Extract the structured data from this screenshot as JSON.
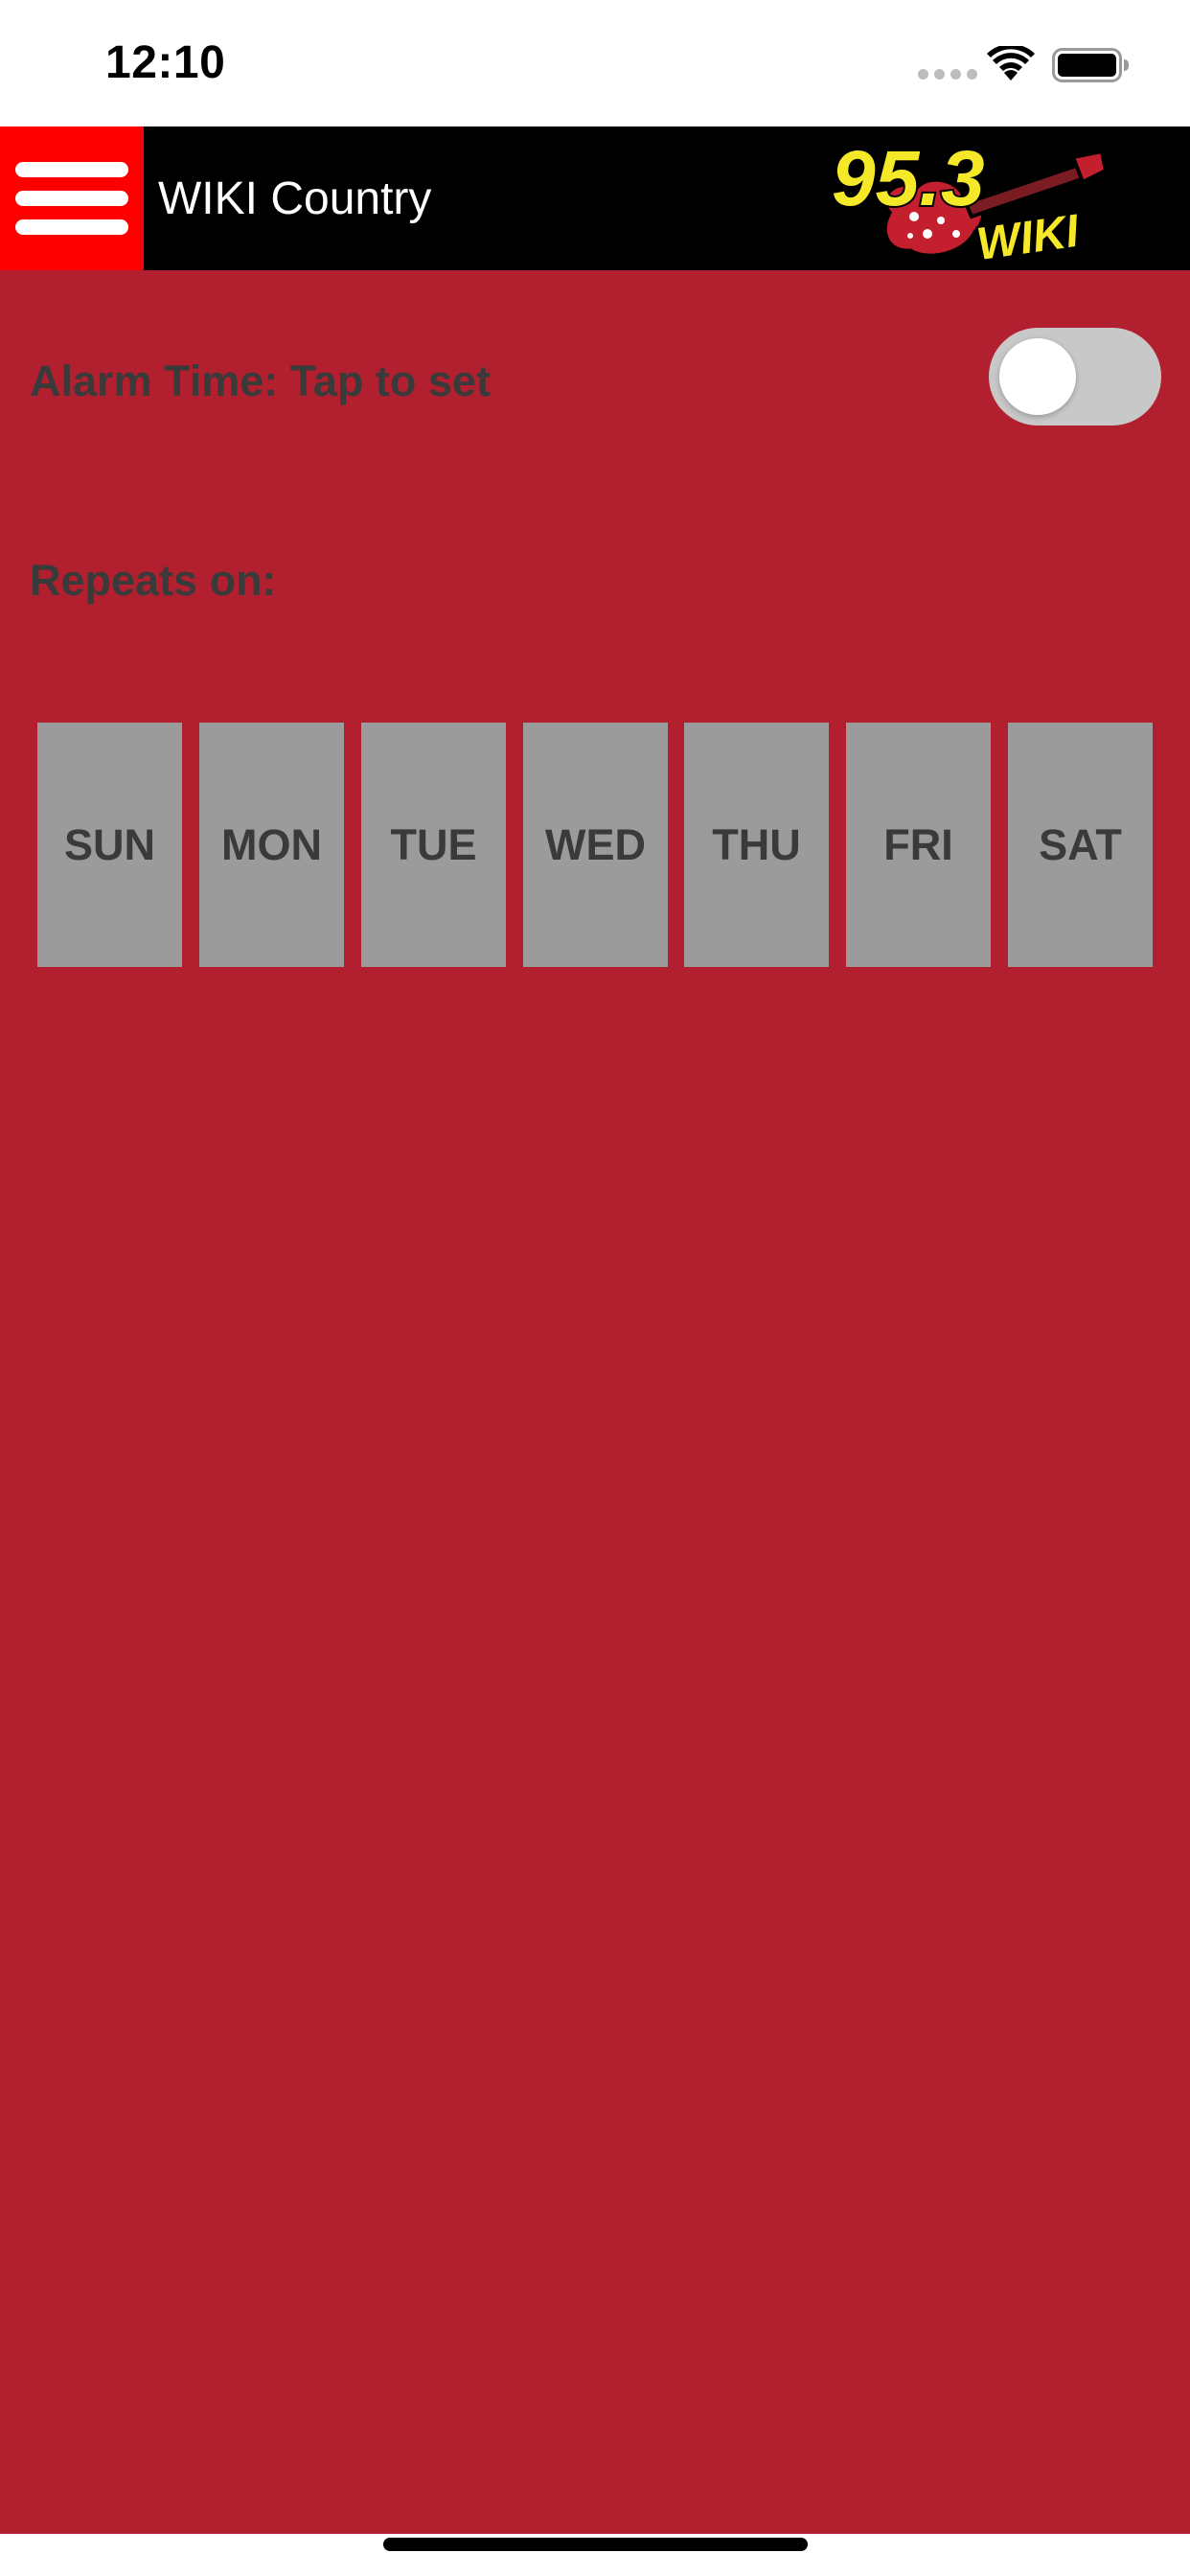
{
  "status_bar": {
    "time": "12:10",
    "icons": [
      "cellular-signal-icon",
      "wifi-icon",
      "battery-icon"
    ]
  },
  "header": {
    "menu_icon": "hamburger-menu-icon",
    "title": "WIKI Country",
    "logo": {
      "number_text": "95.3",
      "call_letters": "WIKI",
      "colors": {
        "number": "#f5e829",
        "guitar": "#c41f2e",
        "outline": "#000000"
      }
    }
  },
  "alarm": {
    "time_label": "Alarm Time: Tap to set",
    "enabled": false
  },
  "repeats": {
    "label": "Repeats on:",
    "days": [
      {
        "label": "SUN",
        "selected": false
      },
      {
        "label": "MON",
        "selected": false
      },
      {
        "label": "TUE",
        "selected": false
      },
      {
        "label": "WED",
        "selected": false
      },
      {
        "label": "THU",
        "selected": false
      },
      {
        "label": "FRI",
        "selected": false
      },
      {
        "label": "SAT",
        "selected": false
      }
    ]
  },
  "colors": {
    "background": "#b2202f",
    "header": "#000000",
    "menu_button": "#ff0000",
    "day_button": "#9b9b9b",
    "label_text": "#3a3a3a",
    "toggle_off": "#c8c8c8"
  }
}
